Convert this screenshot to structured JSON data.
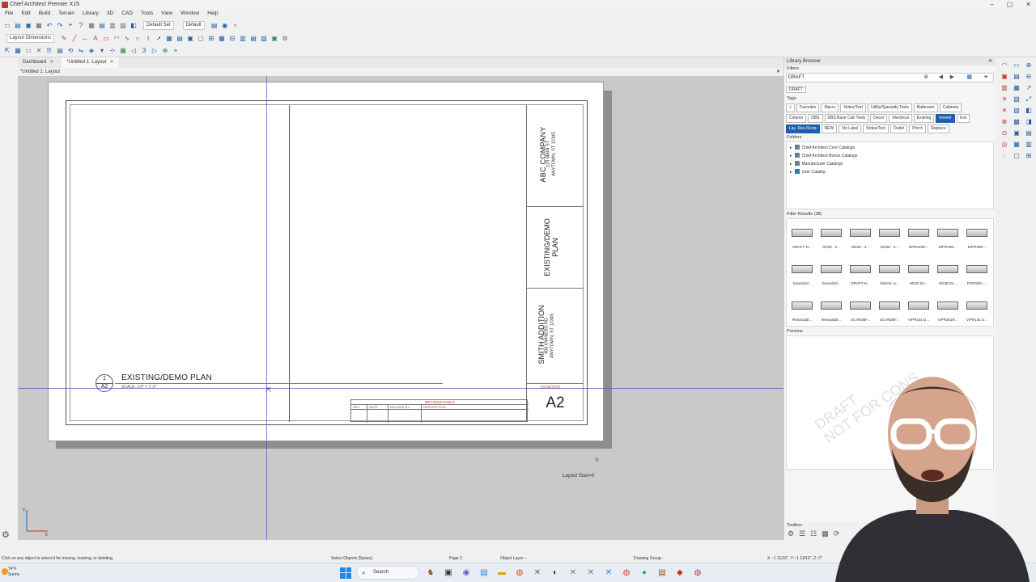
{
  "app": {
    "title": "Chief Architect Premier X15"
  },
  "menu": [
    "File",
    "Edit",
    "Build",
    "Terrain",
    "Library",
    "3D",
    "CAD",
    "Tools",
    "View",
    "Window",
    "Help"
  ],
  "toolbar": {
    "default_set": "Default Set",
    "default": "Default",
    "layout_dimensions": "Layout Dimensions"
  },
  "tabs": [
    {
      "label": "Dashboard"
    },
    {
      "label": "*Untitled 1: Layout"
    }
  ],
  "document": {
    "title": "*Untitled 1: Layout"
  },
  "sheet": {
    "company": "ABC COMPANY",
    "company_address": [
      "123 MAIN ST",
      "ANYTOWN, ST 12345"
    ],
    "plan_title": [
      "EXISTING/DEMO",
      "PLAN"
    ],
    "client_name": "SMITH ADDITION",
    "client_address": [
      "456 OWNERS RD",
      "ANYTOWN, ST 12345"
    ],
    "date": "10/24/2023",
    "sheet_number": "A2",
    "revision_table": {
      "title": "REVISION TABLE",
      "cols": [
        "REV",
        "DATE",
        "REVISED BY",
        "DESCRIPTION"
      ]
    },
    "view": {
      "callout_top": "1",
      "callout_bottom": "A2",
      "title": "EXISTING/DEMO PLAN",
      "scale": "SCALE: 1/4\" = 1'-0\""
    }
  },
  "canvas": {
    "zero_label": "0",
    "layout_start": "Layout Start=0",
    "axis_x": "X",
    "axis_y": "Y"
  },
  "library": {
    "title": "Library Browser",
    "filters_label": "Filters",
    "search_value": "DRAFT",
    "search_chip": "DRAFT",
    "tags_label": "Tags",
    "tag_rows": [
      [
        "Favorites",
        "Macro",
        "Notes/Text",
        "Utility/Specialty Tools",
        "Bathroom",
        "Cabinets"
      ],
      [
        "Column",
        "DBS",
        "DBS Base Cab Tools",
        "Decor",
        "Electrical",
        "Existing",
        "Interior",
        "Iron"
      ],
      [
        "Lay. Res./Scrip",
        "NEW",
        "No Label",
        "Notes/Text",
        "Outlet",
        "Porch",
        "Replace"
      ]
    ],
    "selected_tag": "Interior",
    "folders_label": "Folders",
    "folders": [
      "Chief Architect Core Catalogs",
      "Chief Architect Bonus Catalogs",
      "Manufacturer Catalogs",
      "User Catalog"
    ],
    "results_label": "Filter Results (38)",
    "results": [
      "DRAFT N...",
      "DD30 - 3...",
      "DD36 - 3...",
      "DD45 - 4...",
      "DIPR100F...",
      "DIPR30R...",
      "DIPR36R...",
      "Downdraf...",
      "Downdraf...",
      "DRAFT-N...",
      "Electric w...",
      "HD30 Do...",
      "HD36 Do...",
      "PGPI830 -...",
      "Retractabl...",
      "Retractabl...",
      "UCVM30F...",
      "UCVM36F...",
      "VIPR101 D...",
      "VIPR301R...",
      "VIPR161 D..."
    ],
    "preview_label": "Preview",
    "watermark": [
      "DRAFT",
      "NOT FOR CONS"
    ],
    "toolbox_label": "Toolbox"
  },
  "status": {
    "hint": "Click on any object to select it for moving, resizing, or deleting.",
    "select": "Select Objects [Space]",
    "page": "Page 3",
    "layer": "Object Layer: -",
    "group": "Drawing Group: -",
    "coords": "X: -1 11/16\", Y: -1 13/16\", Z: 0\""
  },
  "taskbar": {
    "temp": "74°F",
    "condition": "Sunny",
    "search": "Search"
  }
}
